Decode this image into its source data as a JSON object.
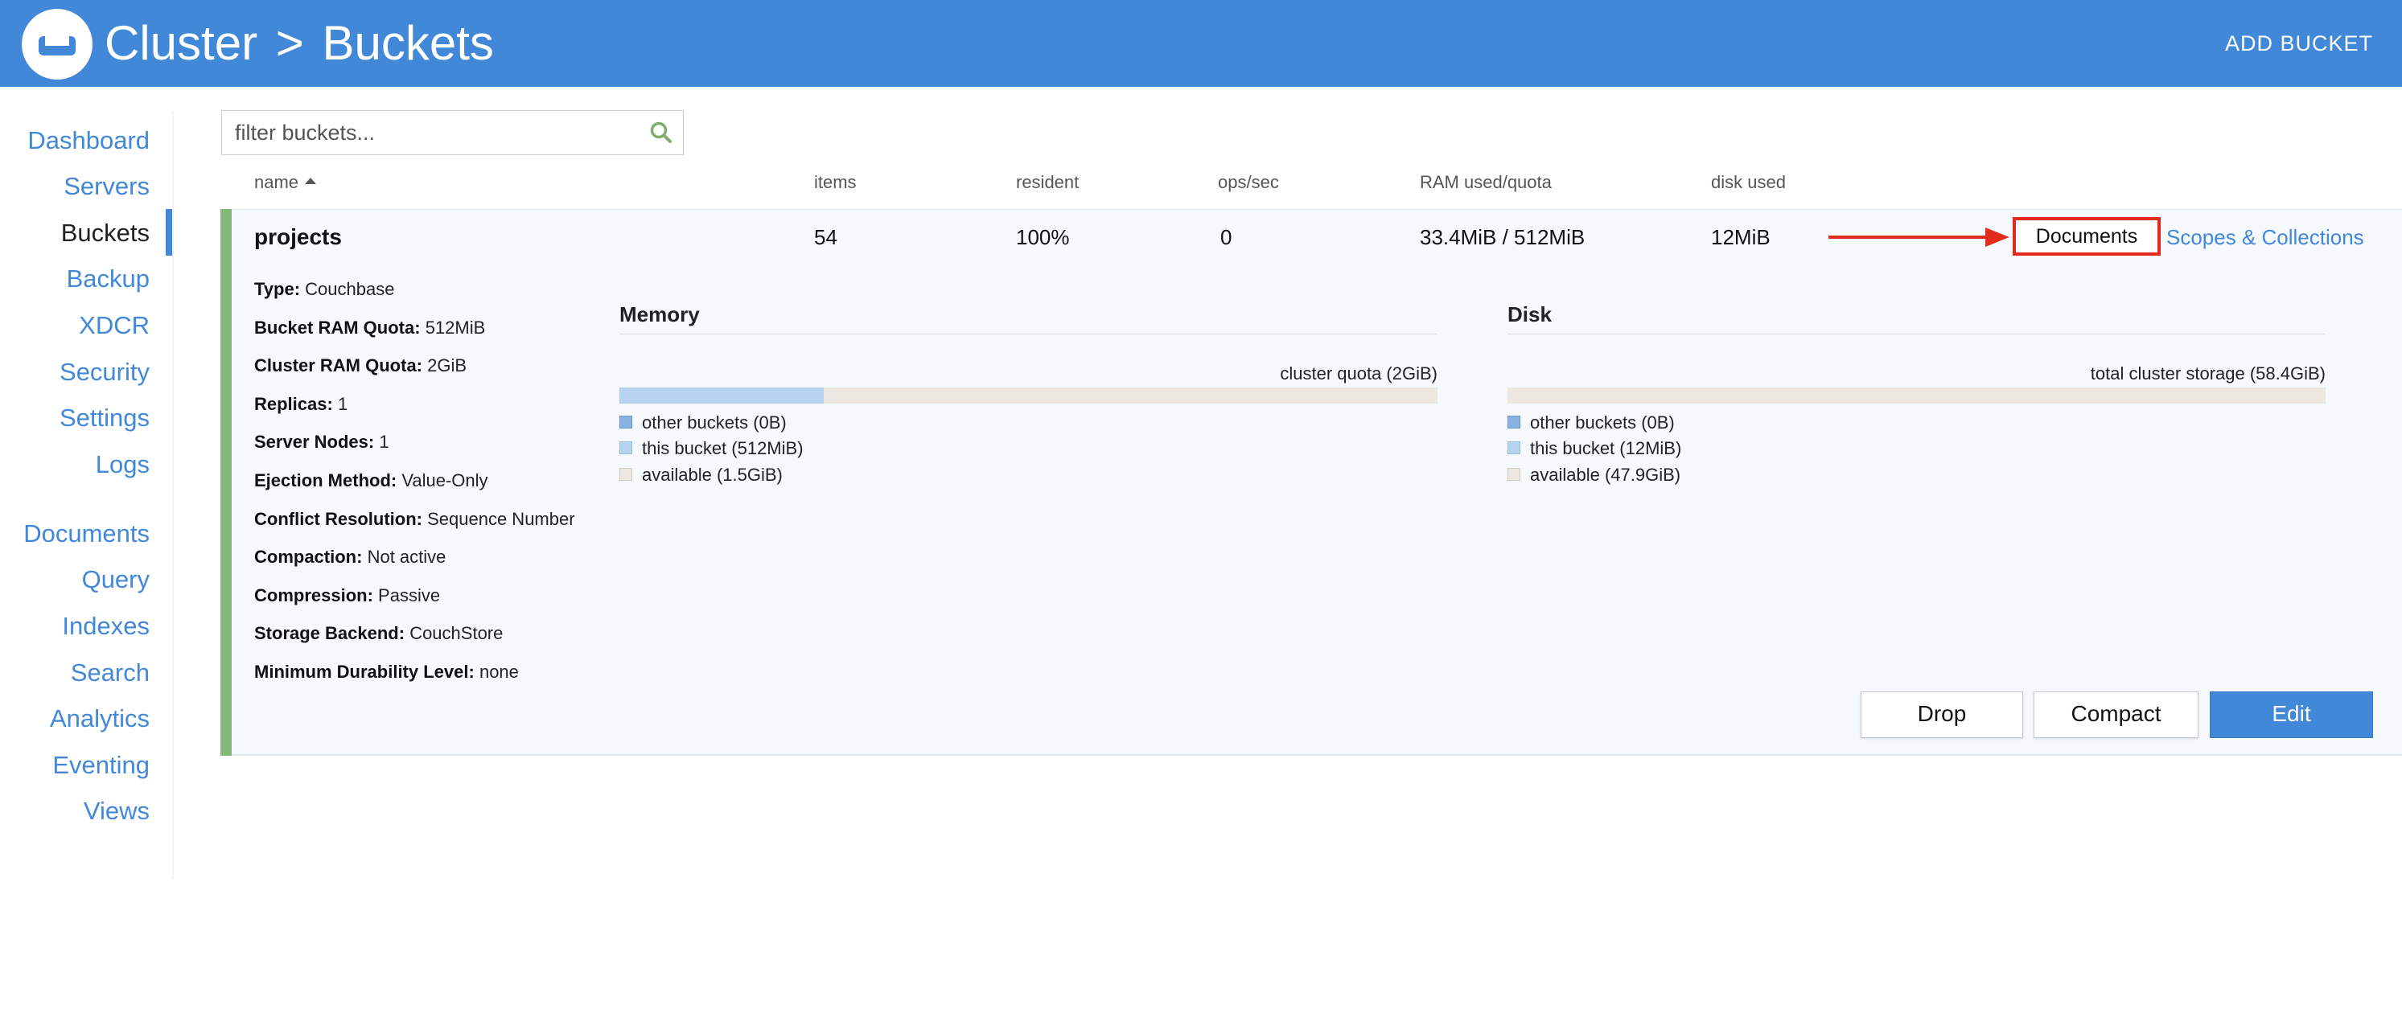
{
  "header": {
    "breadcrumb_root": "Cluster",
    "breadcrumb_separator": ">",
    "breadcrumb_current": "Buckets",
    "add_bucket_label": "ADD BUCKET",
    "brand_color": "#4288d9"
  },
  "sidebar": {
    "items": [
      {
        "label": "Dashboard"
      },
      {
        "label": "Servers"
      },
      {
        "label": "Buckets",
        "active": true
      },
      {
        "label": "Backup"
      },
      {
        "label": "XDCR"
      },
      {
        "label": "Security"
      },
      {
        "label": "Settings"
      },
      {
        "label": "Logs"
      },
      {
        "label": "Documents"
      },
      {
        "label": "Query"
      },
      {
        "label": "Indexes"
      },
      {
        "label": "Search"
      },
      {
        "label": "Analytics"
      },
      {
        "label": "Eventing"
      },
      {
        "label": "Views"
      }
    ]
  },
  "search": {
    "placeholder": "filter buckets...",
    "value": "",
    "icon": "search-icon"
  },
  "table": {
    "columns": [
      "name",
      "items",
      "resident",
      "ops/sec",
      "RAM used/quota",
      "disk used"
    ],
    "sort_column": "name",
    "sort_direction": "ascending"
  },
  "bucket": {
    "name": "projects",
    "items": "54",
    "resident": "100%",
    "ops_sec": "0",
    "ram_used_quota": "33.4MiB / 512MiB",
    "disk_used": "12MiB",
    "documents_label": "Documents",
    "scopes_label": "Scopes & Collections",
    "details": [
      {
        "label": "Type:",
        "value": "Couchbase"
      },
      {
        "label": "Bucket RAM Quota:",
        "value": "512MiB"
      },
      {
        "label": "Cluster RAM Quota:",
        "value": "2GiB"
      },
      {
        "label": "Replicas:",
        "value": "1"
      },
      {
        "label": "Server Nodes:",
        "value": "1"
      },
      {
        "label": "Ejection Method:",
        "value": "Value-Only"
      },
      {
        "label": "Conflict Resolution:",
        "value": "Sequence Number"
      },
      {
        "label": "Compaction:",
        "value": "Not active"
      },
      {
        "label": "Compression:",
        "value": "Passive"
      },
      {
        "label": "Storage Backend:",
        "value": "CouchStore"
      },
      {
        "label": "Minimum Durability Level:",
        "value": "none"
      }
    ],
    "memory": {
      "title": "Memory",
      "total_label": "cluster quota (2GiB)",
      "used_fraction": 0.25,
      "legend": [
        "other buckets (0B)",
        "this bucket (512MiB)",
        "available (1.5GiB)"
      ]
    },
    "disk": {
      "title": "Disk",
      "total_label": "total cluster storage (58.4GiB)",
      "used_fraction": 0.0,
      "legend": [
        "other buckets (0B)",
        "this bucket (12MiB)",
        "available (47.9GiB)"
      ]
    },
    "actions": {
      "drop_label": "Drop",
      "compact_label": "Compact",
      "edit_label": "Edit"
    }
  },
  "colors": {
    "row_accent": "#84b979",
    "highlight_annotation": "#e32b1d",
    "link": "#4288d9"
  }
}
